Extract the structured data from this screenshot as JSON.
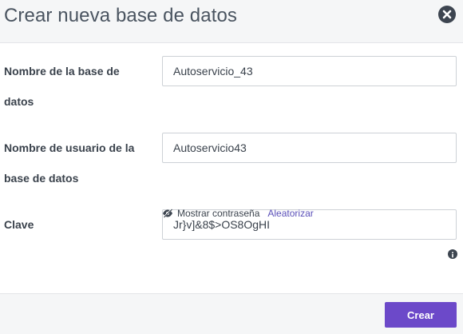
{
  "dialog": {
    "title": "Crear nueva base de datos",
    "close_icon": "close-icon"
  },
  "form": {
    "db_name": {
      "label": "Nombre de la base de datos",
      "value": "Autoservicio_43"
    },
    "db_user": {
      "label": "Nombre de usuario de la base de datos",
      "value": "Autoservicio43"
    },
    "password": {
      "label": "Clave",
      "value": "Jr}v]&8$>OS8OgHI",
      "show_password_label": "Mostrar contraseña",
      "randomize_label": "Aleatorizar",
      "info_icon": "info-icon",
      "eye_icon": "eye-slash-icon"
    }
  },
  "footer": {
    "create_label": "Crear"
  },
  "colors": {
    "accent": "#6c49c9",
    "link": "#5a4fb8",
    "header_bg": "#f5f6f7"
  }
}
